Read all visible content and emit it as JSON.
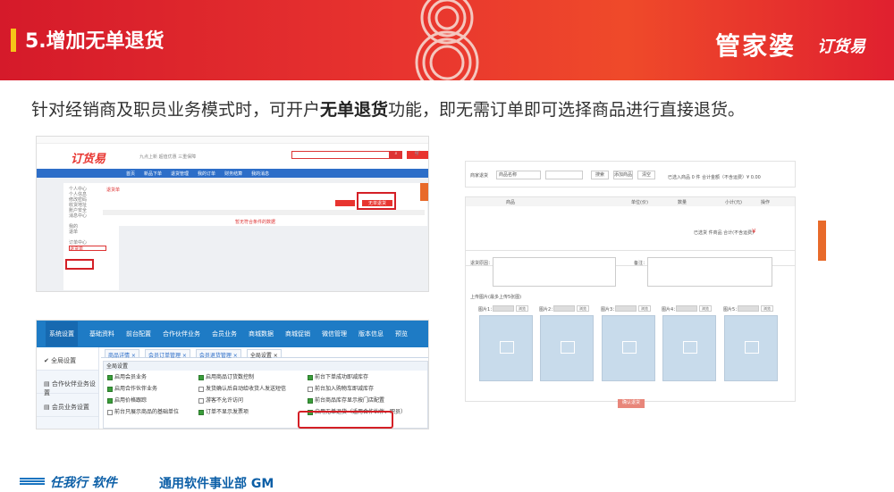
{
  "slide": {
    "title": "5.增加无单退货",
    "brand": "管家婆",
    "brand_sub": "订货易",
    "subtitle_pre": "针对经销商及职员业务模式时，可开户",
    "subtitle_bold": "无单退货",
    "subtitle_post": "功能，即无需订单即可选择商品进行直接退货。"
  },
  "shot1": {
    "logo": "订货易",
    "slogans": "九点上新   超值优惠   三重保障",
    "nav": [
      "首页",
      "新品下单",
      "退货管理",
      "我的订单",
      "财务结算",
      "我的消息"
    ],
    "sidebar": [
      "个人中心",
      "个人信息",
      "修改密码",
      "收货地址",
      "账户安全",
      "消息中心",
      "",
      "我的",
      "退单",
      "",
      "订单中心",
      "退货单"
    ],
    "tab": "退货单",
    "btn_new": "无单退货",
    "empty": "暂无符合条件的数据"
  },
  "shot2": {
    "nav": [
      "系统设置",
      "基础资料",
      "前台配置",
      "合作伙伴业务",
      "会员业务",
      "商城数据",
      "商城促销",
      "微信管理",
      "版本信息",
      "预览"
    ],
    "left": [
      "全局设置",
      "合作伙伴业务设置",
      "会员业务设置"
    ],
    "tabs": [
      "商品详情 ×",
      "会员订单管理 ×",
      "会员退货管理 ×",
      "全局设置 ×"
    ],
    "panel_title": "全局设置",
    "options": [
      {
        "label": "启用会员业务",
        "on": true
      },
      {
        "label": "启用合作伙伴业务",
        "on": true
      },
      {
        "label": "启用价格跟踪",
        "on": true
      },
      {
        "label": "前台只展示商品的基础单位",
        "on": false
      },
      {
        "label": "启用商品订货数控制",
        "on": true
      },
      {
        "label": "发货确认后自动给收货人发送短信",
        "on": false
      },
      {
        "label": "游客不允许访问",
        "on": false
      },
      {
        "label": "订单不显示发票项",
        "on": true
      },
      {
        "label": "前台下单成功即减库存",
        "on": true
      },
      {
        "label": "前台加入购物车即减库存",
        "on": false
      },
      {
        "label": "前台商品库存显示按门店配置",
        "on": true
      },
      {
        "label": "启用无单退货（适用合作伙伴、职员）",
        "on": true
      }
    ]
  },
  "shot3": {
    "store_label": "商家退货",
    "goods_placeholder": "商品名称",
    "btn_search": "搜索",
    "btn_add": "添加商品",
    "btn_clear": "清空",
    "summary": "已选入商品 0 件 合计金额（不含运费）¥ 0.00",
    "table_headers": [
      "商品",
      "单位(价)",
      "数量",
      "小计(元)",
      "操作"
    ],
    "subtotal": "已选货 件商品 合计(不含运费)",
    "reason_label": "退货原因：",
    "note_label": "备注：",
    "upload_label": "上传图片(最多上传5张图)",
    "images": [
      "图片1：",
      "图片2：",
      "图片3：",
      "图片4：",
      "图片5："
    ],
    "browse": "浏览",
    "submit": "确认退货"
  },
  "footer": {
    "company": "任我行 软件",
    "division": "通用软件事业部 GM"
  },
  "colors": {
    "banner": "#e8342f",
    "nav": "#1e7bc5",
    "highlight": "#d41f26"
  }
}
